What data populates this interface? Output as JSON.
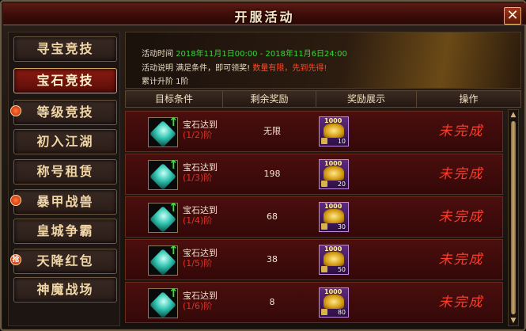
{
  "window": {
    "title": "开服活动",
    "close_glyph": "✕"
  },
  "sidebar": {
    "items": [
      {
        "label": "寻宝竞技",
        "active": false,
        "badge": ""
      },
      {
        "label": "宝石竞技",
        "active": true,
        "badge": ""
      },
      {
        "label": "等级竞技",
        "active": false,
        "badge": "dot"
      },
      {
        "label": "初入江湖",
        "active": false,
        "badge": ""
      },
      {
        "label": "称号租赁",
        "active": false,
        "badge": ""
      },
      {
        "label": "暴甲战兽",
        "active": false,
        "badge": "dot"
      },
      {
        "label": "皇城争霸",
        "active": false,
        "badge": ""
      },
      {
        "label": "天降红包",
        "active": false,
        "badge": "抢"
      },
      {
        "label": "神魔战场",
        "active": false,
        "badge": ""
      }
    ]
  },
  "info": {
    "time_label": "活动时间",
    "time_value": "2018年11月1日00:00 - 2018年11月6日24:00",
    "desc_label": "活动说明",
    "desc_text": "满足条件，即可领奖!",
    "desc_highlight": "数量有限，先到先得!",
    "progress_text": "累计升阶 1阶"
  },
  "table": {
    "headers": [
      "目标条件",
      "剩余奖励",
      "奖励展示",
      "操作"
    ],
    "rows": [
      {
        "target": "宝石达到",
        "stage": "(1/2)阶",
        "remain": "无限",
        "reward_amount": "1000",
        "reward_count": "10",
        "status": "未完成"
      },
      {
        "target": "宝石达到",
        "stage": "(1/3)阶",
        "remain": "198",
        "reward_amount": "1000",
        "reward_count": "20",
        "status": "未完成"
      },
      {
        "target": "宝石达到",
        "stage": "(1/4)阶",
        "remain": "68",
        "reward_amount": "1000",
        "reward_count": "30",
        "status": "未完成"
      },
      {
        "target": "宝石达到",
        "stage": "(1/5)阶",
        "remain": "38",
        "reward_amount": "1000",
        "reward_count": "50",
        "status": "未完成"
      },
      {
        "target": "宝石达到",
        "stage": "(1/6)阶",
        "remain": "8",
        "reward_amount": "1000",
        "reward_count": "80",
        "status": "未完成"
      }
    ]
  },
  "scrollbar": {
    "up_glyph": "▲",
    "down_glyph": "▼"
  },
  "colors": {
    "accent_red": "#ff3b2a",
    "time_green": "#39d43b",
    "gold_text": "#f1d7a6"
  }
}
